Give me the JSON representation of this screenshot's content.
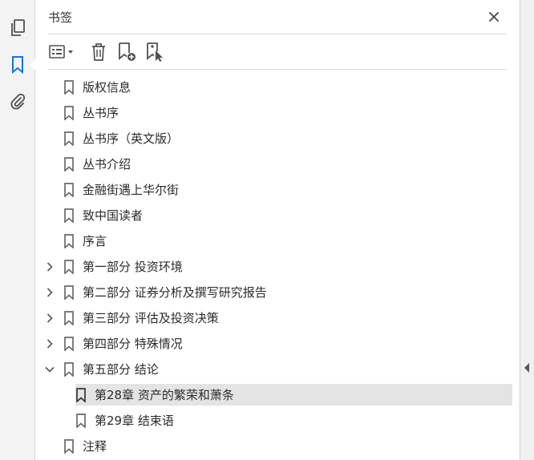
{
  "panel": {
    "title": "书签"
  },
  "rail": {
    "items": [
      {
        "icon": "pages-icon",
        "active": false
      },
      {
        "icon": "bookmark-icon",
        "active": true
      },
      {
        "icon": "attachment-icon",
        "active": false
      }
    ]
  },
  "toolbar": {
    "buttons": [
      "options-menu-icon",
      "delete-bookmark-icon",
      "new-bookmark-icon",
      "bookmark-from-selection-icon"
    ]
  },
  "bookmarks": [
    {
      "label": "版权信息",
      "level": 0,
      "expand": "none"
    },
    {
      "label": "丛书序",
      "level": 0,
      "expand": "none"
    },
    {
      "label": "丛书序（英文版）",
      "level": 0,
      "expand": "none"
    },
    {
      "label": "丛书介绍",
      "level": 0,
      "expand": "none"
    },
    {
      "label": "金融街遇上华尔街",
      "level": 0,
      "expand": "none"
    },
    {
      "label": "致中国读者",
      "level": 0,
      "expand": "none"
    },
    {
      "label": "序言",
      "level": 0,
      "expand": "none"
    },
    {
      "label": "第一部分 投资环境",
      "level": 0,
      "expand": "collapsed"
    },
    {
      "label": "第二部分 证券分析及撰写研究报告",
      "level": 0,
      "expand": "collapsed"
    },
    {
      "label": "第三部分 评估及投资决策",
      "level": 0,
      "expand": "collapsed"
    },
    {
      "label": "第四部分 特殊情况",
      "level": 0,
      "expand": "collapsed"
    },
    {
      "label": "第五部分 结论",
      "level": 0,
      "expand": "expanded"
    },
    {
      "label": "第28章 资产的繁荣和萧条",
      "level": 1,
      "expand": "none",
      "selected": true
    },
    {
      "label": "第29章 结束语",
      "level": 1,
      "expand": "none"
    },
    {
      "label": "注释",
      "level": 0,
      "expand": "none"
    }
  ],
  "colors": {
    "rail_bg": "#f3f3f3",
    "active_icon": "#1473e6",
    "icon": "#505050",
    "selected_row": "#e4e4e4"
  }
}
